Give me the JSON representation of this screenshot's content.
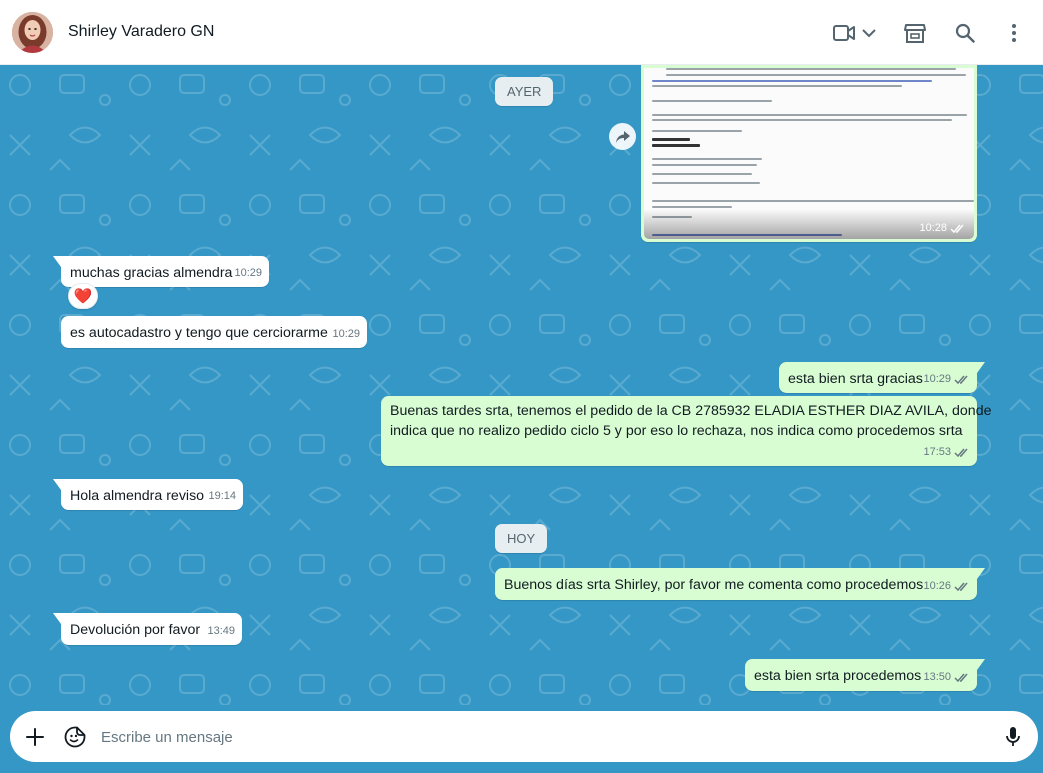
{
  "header": {
    "contact_name": "Shirley Varadero GN",
    "icons": [
      "video-call-icon",
      "chevron-down-icon",
      "shop-icon",
      "search-icon",
      "more-menu-icon"
    ]
  },
  "chat": {
    "image_message": {
      "time": "10:28",
      "status": "read"
    },
    "date_separators": {
      "yesterday": "AYER",
      "today": "HOY"
    },
    "messages": [
      {
        "direction": "in",
        "text": "muchas gracias almendra",
        "time": "10:29",
        "reaction": "❤️"
      },
      {
        "direction": "in",
        "text": "es autocadastro y tengo que cerciorarme",
        "time": "10:29"
      },
      {
        "direction": "out",
        "text": "esta bien srta gracias",
        "time": "10:29",
        "status": "read"
      },
      {
        "direction": "out",
        "lines": [
          "Buenas tardes srta, tenemos el pedido de la CB 2785932 ELADIA ESTHER DIAZ AVILA, donde",
          "indica que no realizo pedido ciclo 5 y por eso lo rechaza, nos indica como procedemos srta"
        ],
        "time": "17:53",
        "status": "read"
      },
      {
        "direction": "in",
        "text": "Hola almendra reviso",
        "time": "19:14"
      },
      {
        "direction": "out",
        "text": "Buenos días srta Shirley, por favor me comenta como procedemos",
        "time": "10:26",
        "status": "read"
      },
      {
        "direction": "in",
        "text": "Devolución por favor",
        "time": "13:49"
      },
      {
        "direction": "out",
        "text": "esta bien srta procedemos",
        "time": "13:50",
        "status": "read"
      }
    ]
  },
  "composer": {
    "placeholder": "Escribe un mensaje",
    "icons": [
      "plus-icon",
      "sticker-icon",
      "microphone-icon"
    ]
  },
  "colors": {
    "wallpaper": "#3597c6",
    "incoming_bubble": "#ffffff",
    "outgoing_bubble": "#d9fdd3",
    "read_ticks": "#53bdeb"
  }
}
